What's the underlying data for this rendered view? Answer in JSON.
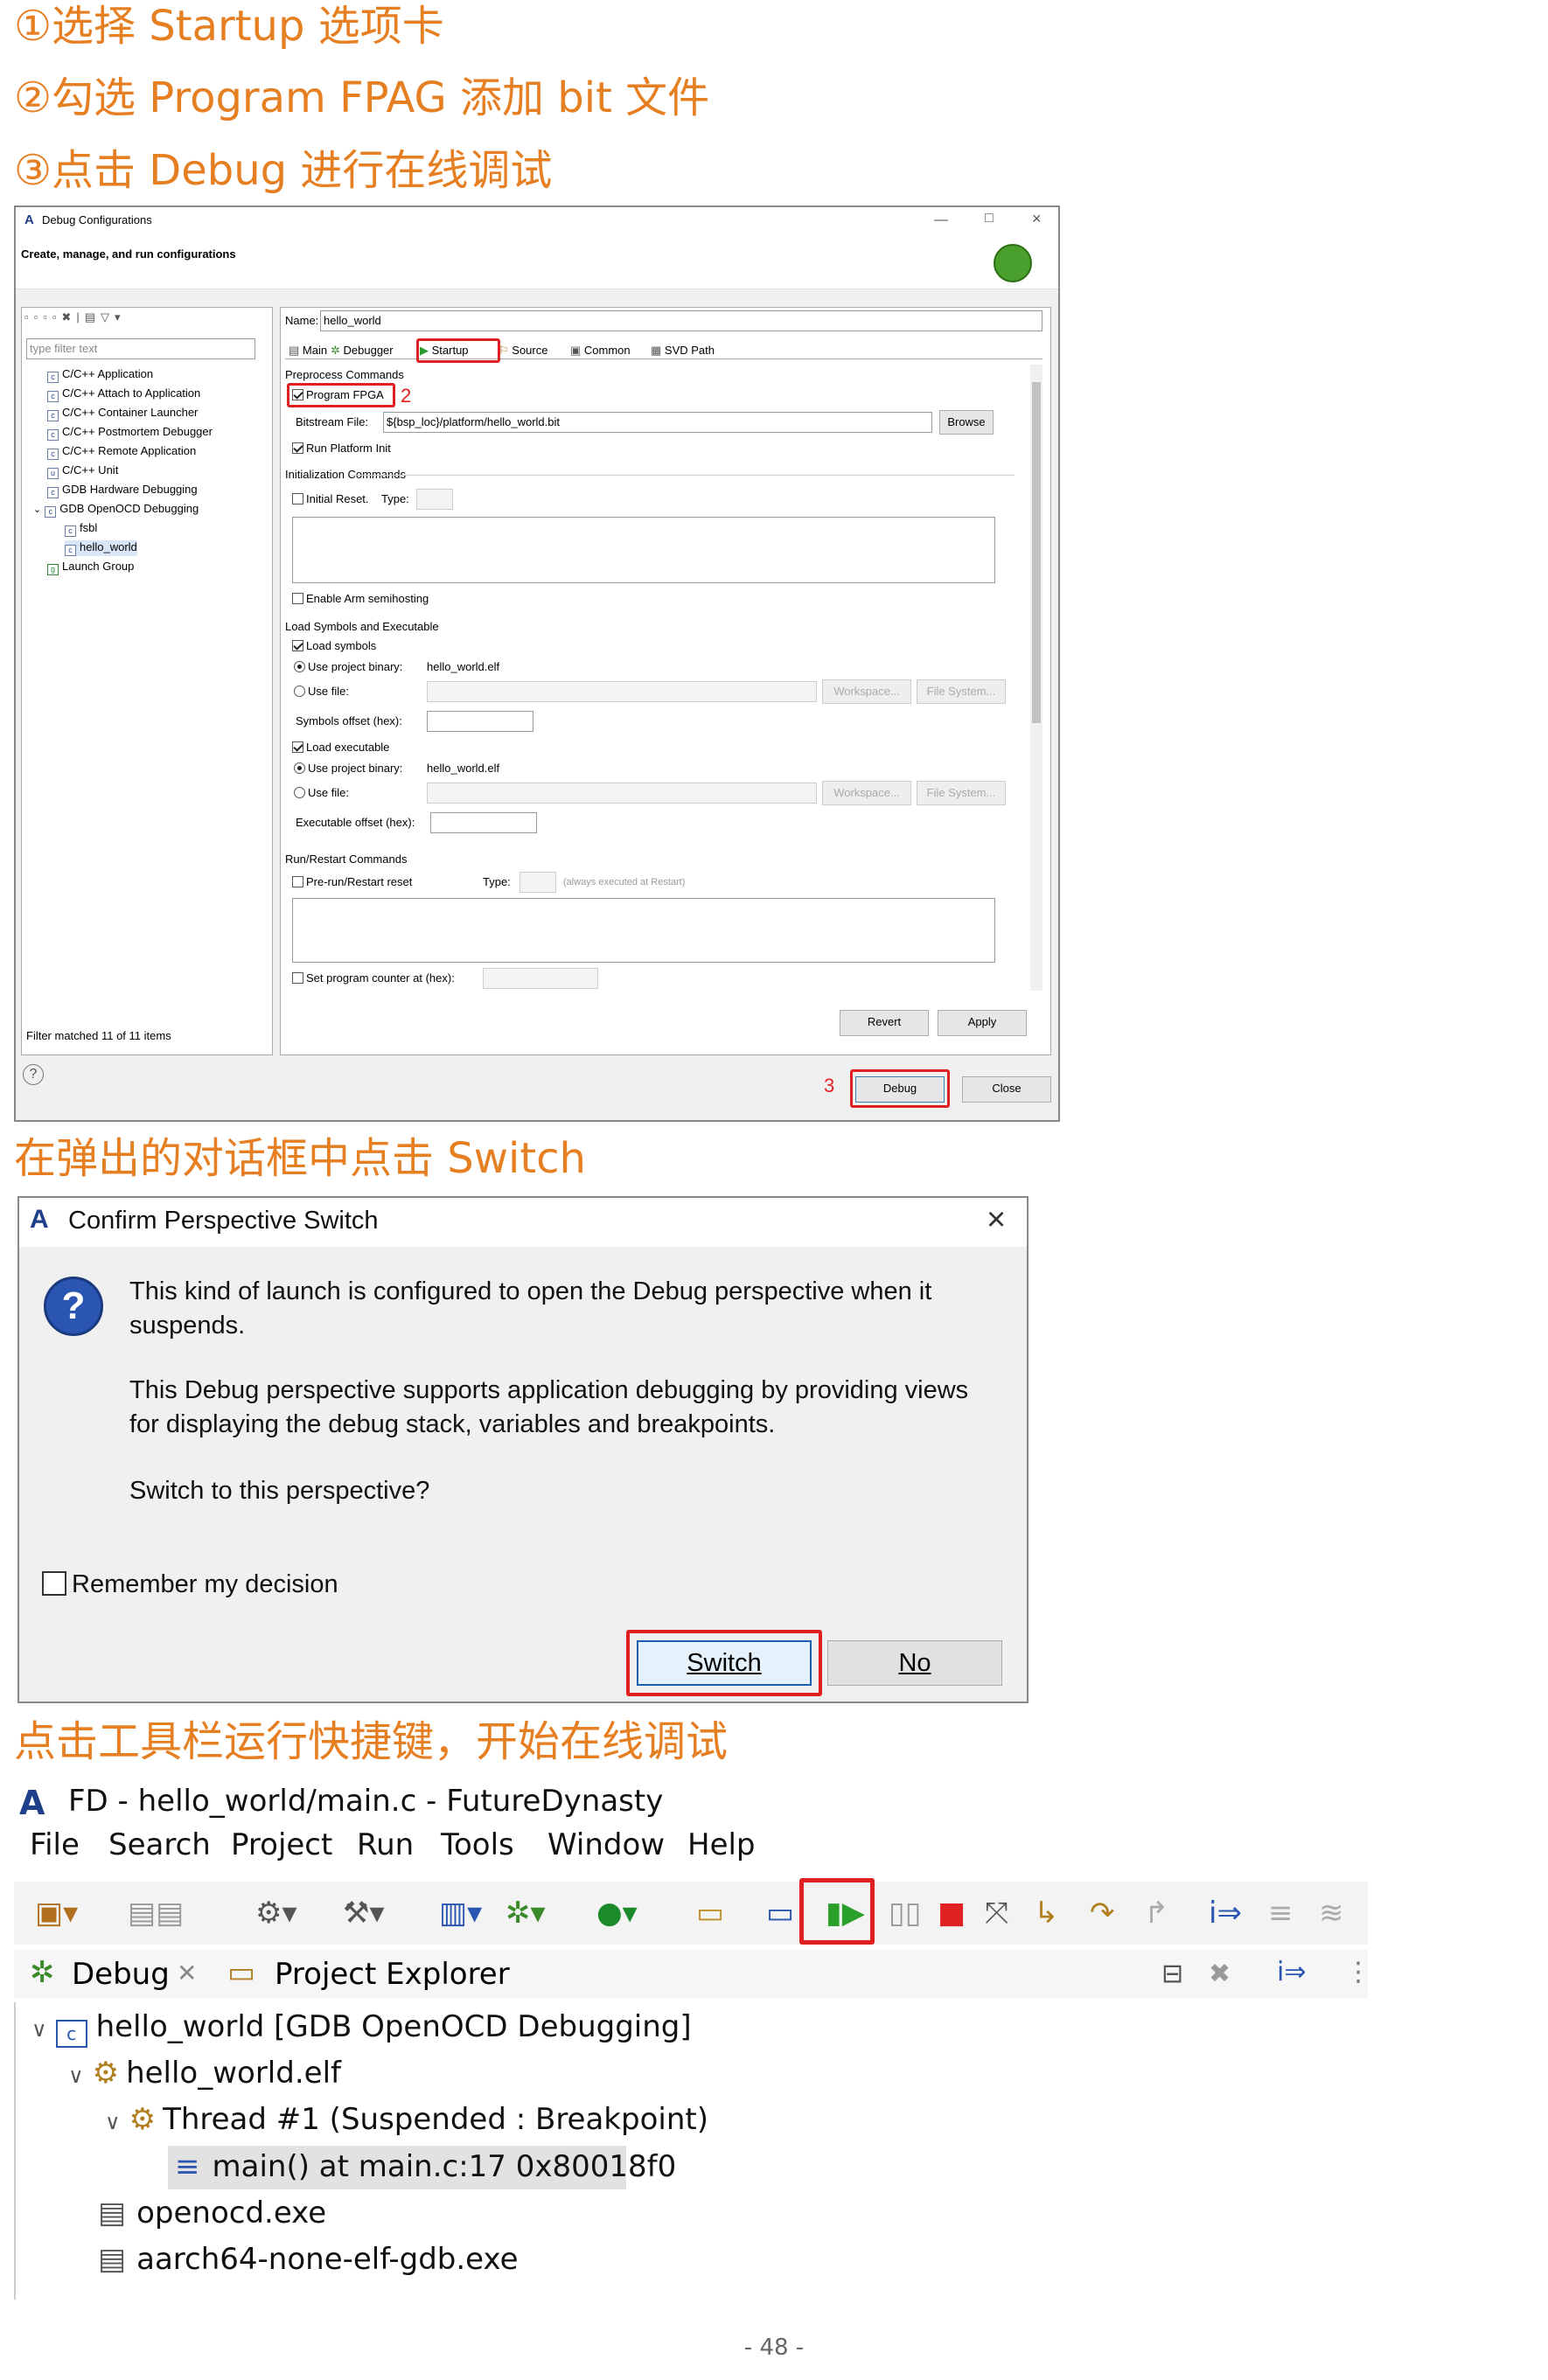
{
  "steps": {
    "s1": "①选择 Startup 选项卡",
    "s2": "②勾选 Program  FPAG 添加 bit 文件",
    "s3": "③点击 Debug 进行在线调试",
    "s4": "在弹出的对话框中点击 Switch",
    "s5": "点击工具栏运行快捷键，开始在线调试"
  },
  "debug_config": {
    "title": "Debug Configurations",
    "subtitle": "Create, manage, and run configurations",
    "filter_placeholder": "type filter text",
    "tree": [
      "C/C++ Application",
      "C/C++ Attach to Application",
      "C/C++ Container Launcher",
      "C/C++ Postmortem Debugger",
      "C/C++ Remote Application",
      "C/C++ Unit",
      "GDB Hardware Debugging",
      "GDB OpenOCD Debugging",
      "fsbl",
      "hello_world",
      "Launch Group"
    ],
    "filter_status": "Filter matched 11 of 11 items",
    "name_label": "Name:",
    "name_value": "hello_world",
    "tabs": [
      "Main",
      "Debugger",
      "Startup",
      "Source",
      "Common",
      "SVD Path"
    ],
    "preprocess": "Preprocess Commands",
    "program_fpga": "Program FPGA",
    "bitstream_label": "Bitstream File:",
    "bitstream_value": "${bsp_loc}/platform/hello_world.bit",
    "browse": "Browse",
    "run_platform_init": "Run Platform Init",
    "init_commands": "Initialization Commands",
    "initial_reset": "Initial Reset.",
    "type_label": "Type:",
    "enable_semihosting": "Enable Arm semihosting",
    "load_symbols_exec": "Load Symbols and Executable",
    "load_symbols": "Load symbols",
    "use_project_binary": "Use project binary:",
    "elf": "hello_world.elf",
    "use_file": "Use file:",
    "workspace": "Workspace...",
    "file_system": "File System...",
    "symbols_offset": "Symbols offset (hex):",
    "load_executable": "Load executable",
    "executable_offset": "Executable offset (hex):",
    "run_restart": "Run/Restart Commands",
    "pre_run_reset": "Pre-run/Restart reset",
    "always_executed": "(always executed at Restart)",
    "set_pc": "Set program counter at (hex):",
    "revert": "Revert",
    "apply": "Apply",
    "debug": "Debug",
    "close": "Close",
    "num2": "2",
    "num3": "3"
  },
  "confirm": {
    "title": "Confirm Perspective Switch",
    "line1": "This kind of launch is configured to open the Debug perspective when it",
    "line2": "suspends.",
    "line3": "This Debug perspective supports application debugging by providing views",
    "line4": "for displaying the debug stack, variables and breakpoints.",
    "line5": "Switch to this perspective?",
    "remember": "Remember my decision",
    "switch": "Switch",
    "no": "No"
  },
  "ide": {
    "title": "FD - hello_world/main.c - FutureDynasty",
    "menu": [
      "File",
      "Search",
      "Project",
      "Run",
      "Tools",
      "Window",
      "Help"
    ],
    "tab_debug": "Debug",
    "tab_explorer": "Project Explorer",
    "tree": {
      "launch": "hello_world [GDB OpenOCD Debugging]",
      "elf": "hello_world.elf",
      "thread": "Thread #1 (Suspended : Breakpoint)",
      "frame": "main() at main.c:17 0x80018f0",
      "openocd": "openocd.exe",
      "gdb": "aarch64-none-elf-gdb.exe"
    }
  },
  "page_number": "- 48 -",
  "colors": {
    "accent": "#e67e22",
    "highlight": "#e02020"
  }
}
